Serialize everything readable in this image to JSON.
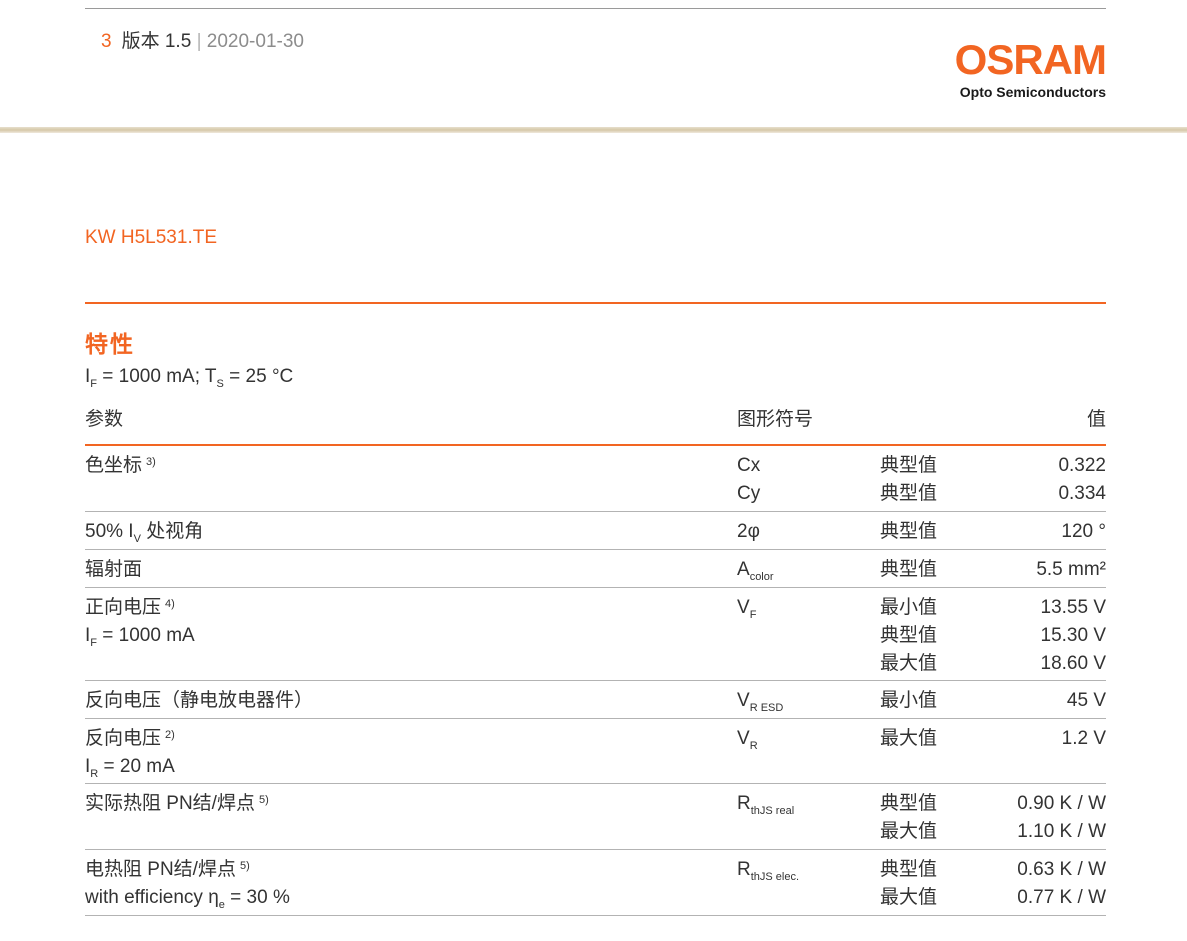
{
  "header": {
    "page_number": "3",
    "version": "版本 1.5",
    "separator": "|",
    "date": "2020-01-30",
    "logo_word": "OSRAM",
    "logo_sub": "Opto Semiconductors"
  },
  "product": "KW H5L531.TE",
  "section": {
    "title": "特性",
    "conditions": {
      "if_symbol": "I",
      "if_sub": "F",
      "if_value": " = 1000 mA; T",
      "ts_sub": "S",
      "ts_value": " = 25 °C"
    },
    "col_param": "参数",
    "col_symbol": "图形符号",
    "col_value": "值"
  },
  "rows": [
    {
      "param": "色坐标",
      "note": "3)",
      "sym1": "Cx",
      "type1": "典型值",
      "val1": "0.322",
      "sym2": "Cy",
      "type2": "典型值",
      "val2": "0.334"
    },
    {
      "param_pre": "50% I",
      "param_sub": "V",
      "param_post": " 处视角",
      "sym": "2φ",
      "type": "典型值",
      "val": "120 °"
    },
    {
      "param": "辐射面",
      "sym_main": "A",
      "sym_sub": "color",
      "type": "典型值",
      "val": "5.5 mm²"
    },
    {
      "param": "正向电压",
      "note": "4)",
      "cond_main": "I",
      "cond_sub": "F",
      "cond_post": " = 1000 mA",
      "sym_main": "V",
      "sym_sub": "F",
      "type1": "最小值",
      "val1": "13.55 V",
      "type2": "典型值",
      "val2": "15.30 V",
      "type3": "最大值",
      "val3": "18.60 V"
    },
    {
      "param": "反向电压（静电放电器件）",
      "sym_main": "V",
      "sym_sub": "R ESD",
      "type": "最小值",
      "val": "45 V"
    },
    {
      "param": "反向电压",
      "note": "2)",
      "cond_main": "I",
      "cond_sub": "R",
      "cond_post": " = 20 mA",
      "sym_main": "V",
      "sym_sub": "R",
      "type": "最大值",
      "val": "1.2 V"
    },
    {
      "param": "实际热阻 PN结/焊点",
      "note": "5)",
      "sym_main": "R",
      "sym_sub": "thJS real",
      "type1": "典型值",
      "val1": "0.90 K / W",
      "type2": "最大值",
      "val2": "1.10 K / W"
    },
    {
      "param": "电热阻 PN结/焊点",
      "note": "5)",
      "cond_main": "with efficiency η",
      "cond_sub": "e",
      "cond_post": " = 30 %",
      "sym_main": "R",
      "sym_sub": "thJS elec.",
      "type1": "典型值",
      "val1": "0.63 K / W",
      "type2": "最大值",
      "val2": "0.77 K / W"
    }
  ]
}
